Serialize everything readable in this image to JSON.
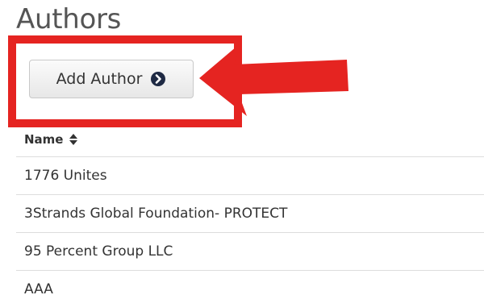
{
  "page": {
    "title": "Authors"
  },
  "toolbar": {
    "add_author_label": "Add Author",
    "add_author_icon": "arrow-circle-right-icon"
  },
  "annotation": {
    "highlight_color": "#e52421",
    "arrow_color": "#e52421"
  },
  "table": {
    "columns": [
      {
        "label": "Name",
        "sort_icon": "sort-icon"
      }
    ],
    "rows": [
      {
        "name": "1776 Unites"
      },
      {
        "name": "3Strands Global Foundation- PROTECT"
      },
      {
        "name": "95 Percent Group LLC"
      },
      {
        "name": "AAA"
      }
    ]
  }
}
